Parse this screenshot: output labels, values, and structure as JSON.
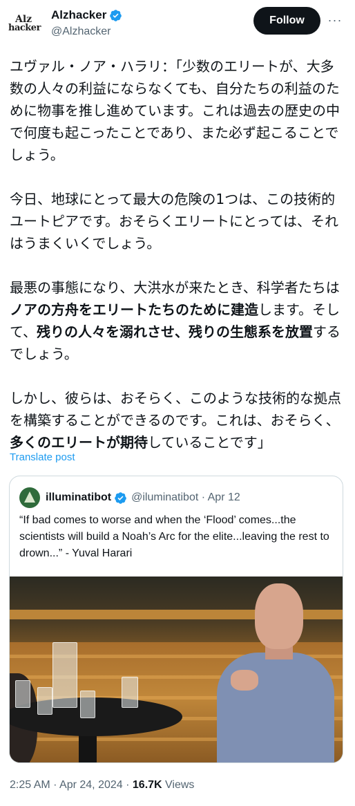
{
  "author": {
    "avatar_line1": "Alz",
    "avatar_line2": "hacker",
    "display_name": "Alzhacker",
    "handle": "@Alzhacker",
    "verified": true
  },
  "actions": {
    "follow_label": "Follow",
    "more_label": "···"
  },
  "post": {
    "p1": "ユヴァル・ノア・ハラリ：「少数のエリートが、大多数の人々の利益にならなくても、自分たちの利益のために物事を推し進めています。これは過去の歴史の中で何度も起こったことであり、また必ず起こることでしょう。",
    "p2": "今日、地球にとって最大の危険の1つは、この技術的ユートピアです。おそらくエリートにとっては、それはうまくいくでしょう。",
    "p3_a": "最悪の事態になり、大洪水が来たとき、科学者たちは",
    "p3_b_bold": "ノアの方舟をエリートたちのために建造",
    "p3_c": "します。そして、",
    "p3_d_bold": "残りの人々を溺れさせ、残りの生態系を放置",
    "p3_e": "するでしょう。",
    "p4_a": "しかし、彼らは、おそらく、このような技術的な拠点を構築することができるのです。これは、おそらく、",
    "p4_b_bold": "多くのエリートが期待",
    "p4_c": "していることです」"
  },
  "translate_label": "Translate post",
  "quoted": {
    "display_name": "illuminatibot",
    "handle_date": "@iluminatibot · Apr 12",
    "text": "“If bad comes to worse and when the ‘Flood’ comes...the scientists will build a Noah’s Arc for the elite...leaving the rest to drown...” - Yuval Harari"
  },
  "meta": {
    "time_date": "2:25 AM · Apr 24, 2024 · ",
    "views_count": "16.7K",
    "views_label": " Views"
  },
  "colors": {
    "accent": "#1d9bf0",
    "text": "#0f1419",
    "muted": "#536471",
    "follow_bg": "#0f1419"
  }
}
